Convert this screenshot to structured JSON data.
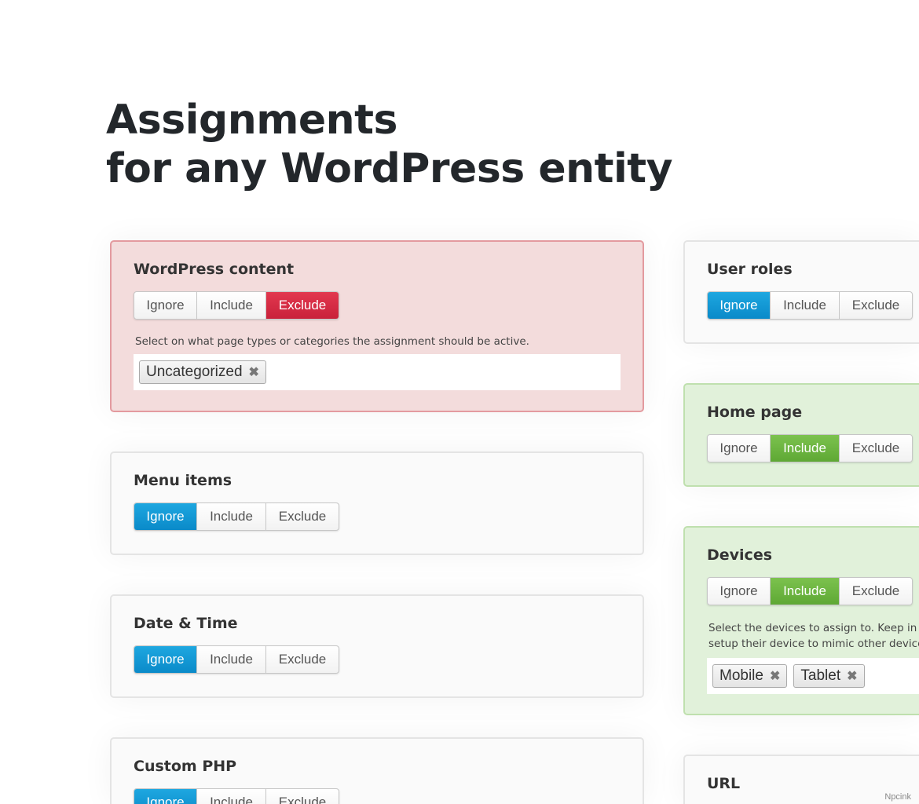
{
  "headline": {
    "line1": "Assignments",
    "line2": "for any WordPress entity"
  },
  "cards": {
    "wordpress_content": {
      "title": "WordPress content",
      "options": [
        "Ignore",
        "Include",
        "Exclude"
      ],
      "selected": "Exclude",
      "description": "Select on what page types or categories the assignment should be active.",
      "tags": [
        "Uncategorized"
      ]
    },
    "menu_items": {
      "title": "Menu items",
      "options": [
        "Ignore",
        "Include",
        "Exclude"
      ],
      "selected": "Ignore"
    },
    "date_time": {
      "title": "Date & Time",
      "options": [
        "Ignore",
        "Include",
        "Exclude"
      ],
      "selected": "Ignore"
    },
    "custom_php": {
      "title": "Custom PHP",
      "options": [
        "Ignore",
        "Include",
        "Exclude"
      ],
      "selected": "Ignore"
    },
    "user_roles": {
      "title": "User roles",
      "options": [
        "Ignore",
        "Include",
        "Exclude"
      ],
      "selected": "Ignore"
    },
    "home_page": {
      "title": "Home page",
      "options": [
        "Ignore",
        "Include",
        "Exclude"
      ],
      "selected": "Include"
    },
    "devices": {
      "title": "Devices",
      "options": [
        "Ignore",
        "Include",
        "Exclude"
      ],
      "selected": "Include",
      "description_line1": "Select the devices to assign to. Keep in mi",
      "description_line2": "setup their device to mimic other devices",
      "tags": [
        "Mobile",
        "Tablet"
      ]
    },
    "url": {
      "title": "URL"
    }
  },
  "tag_remove_icon": "close-icon",
  "colors": {
    "ignore_active": "#1593d3",
    "include_active": "#6cb43f",
    "exclude_active": "#d52a42"
  },
  "watermark": "Npcink"
}
